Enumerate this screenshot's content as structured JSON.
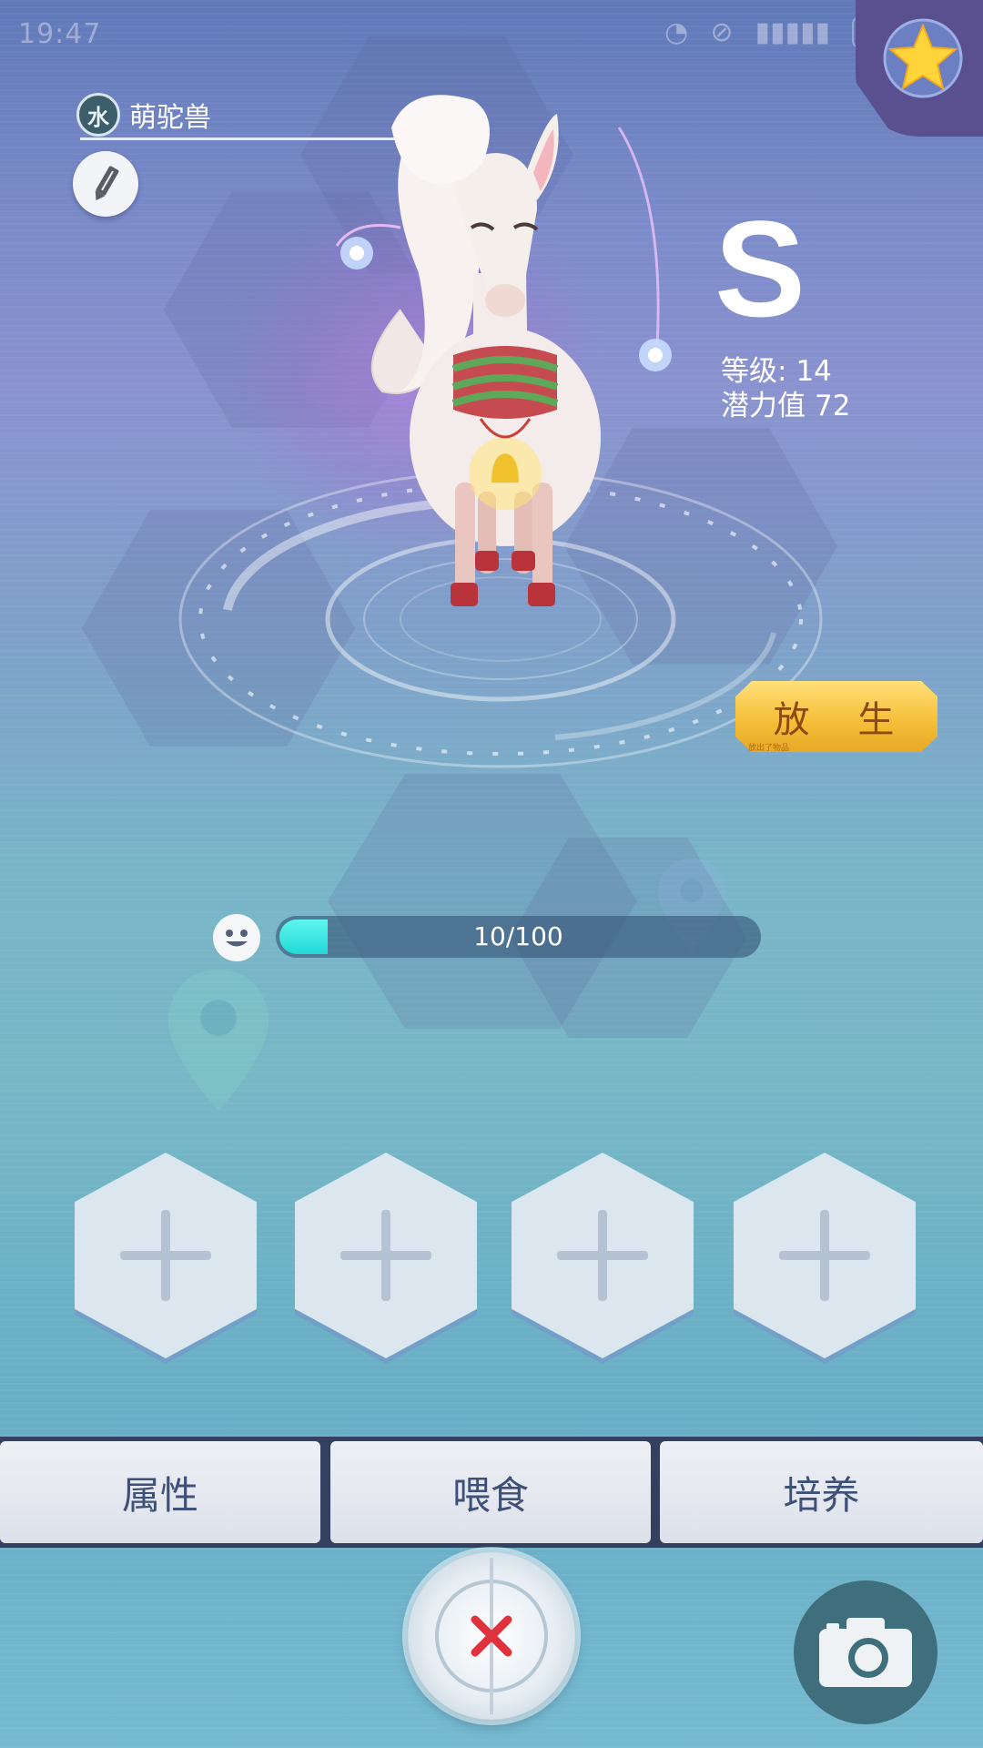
{
  "status_bar": {
    "time": "19:47",
    "icons": [
      "wifi-off-icon",
      "mute-icon",
      "signal-icon",
      "battery-icon"
    ],
    "battery_level": "53"
  },
  "pet": {
    "element": "水",
    "name": "萌驼兽",
    "grade": "S",
    "level_label": "等级:",
    "level_value": "14",
    "potential_label": "潜力值",
    "potential_value": "72"
  },
  "release_button": {
    "label": "放 生",
    "sub": "放出了物品"
  },
  "mood": {
    "text": "10/100",
    "current": 10,
    "max": 100
  },
  "skill_slots": [
    {
      "label": "+"
    },
    {
      "label": "+"
    },
    {
      "label": "+"
    },
    {
      "label": "+"
    }
  ],
  "tabs": [
    {
      "label": "属性"
    },
    {
      "label": "喂食"
    },
    {
      "label": "培养"
    }
  ],
  "colors": {
    "accent_cyan": "#20d8d6",
    "gold": "#f6c03a",
    "tab_text": "#3e5078",
    "close_red": "#e0323c"
  }
}
